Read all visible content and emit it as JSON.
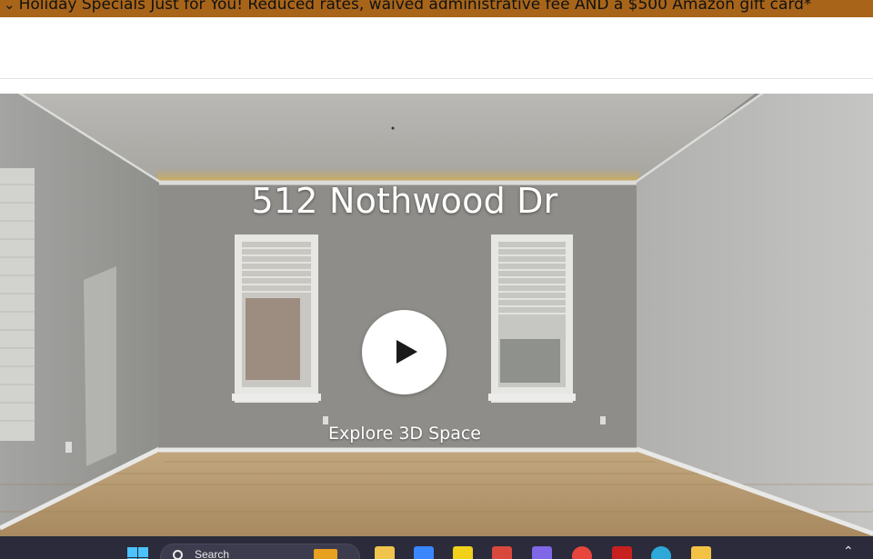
{
  "banner": {
    "text": "Holiday Specials Just for You! Reduced rates,  waived administrative fee AND a $500 Amazon gift card*",
    "chevron_icon": "chevron-down-icon"
  },
  "tour": {
    "title": "512 Nothwood Dr",
    "explore_label": "Explore 3D Space",
    "play_icon": "play-icon"
  },
  "taskbar": {
    "search_label": "Search",
    "apps": [
      {
        "name": "file-explorer-icon",
        "color": "#f0c44c"
      },
      {
        "name": "store-icon",
        "color": "#3a86ff"
      },
      {
        "name": "app-yellow-icon",
        "color": "#f2d11b"
      },
      {
        "name": "app-red-icon",
        "color": "#d8483c"
      },
      {
        "name": "copilot-icon",
        "color": "#7f67e8"
      },
      {
        "name": "chrome-icon",
        "color": "#e8453c"
      },
      {
        "name": "acrobat-icon",
        "color": "#c8201e"
      },
      {
        "name": "edge-icon",
        "color": "#2ea8d8"
      },
      {
        "name": "folder-icon",
        "color": "#f3c245"
      }
    ],
    "tray_icon": "chevron-up-icon"
  }
}
